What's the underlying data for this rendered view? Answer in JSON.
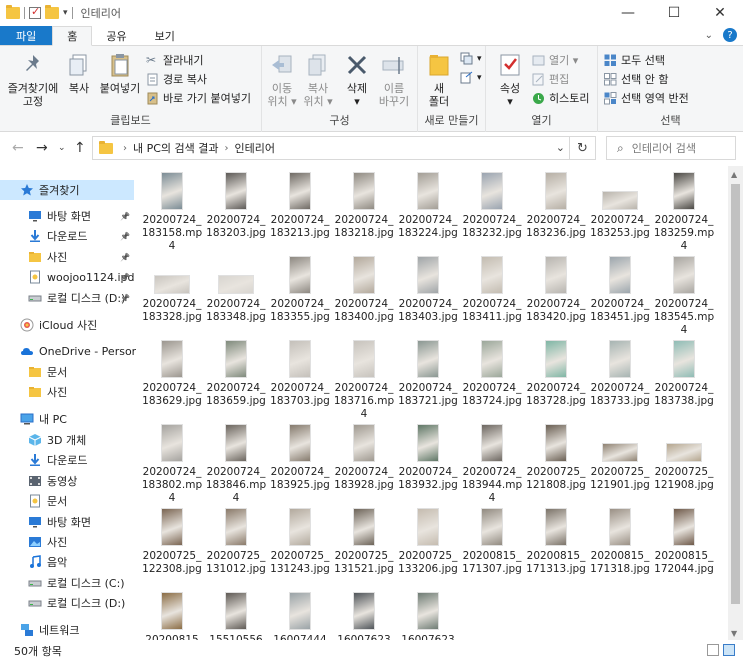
{
  "window": {
    "title": "인테리어",
    "controls": [
      "—",
      "☐",
      "✕"
    ]
  },
  "tabs": [
    {
      "label": "파일"
    },
    {
      "label": "홈"
    },
    {
      "label": "공유"
    },
    {
      "label": "보기"
    }
  ],
  "ribbon": {
    "clipboard": {
      "label": "클립보드",
      "pin": "즐겨찾기에\n고정",
      "copy": "복사",
      "paste": "붙여넣기",
      "cut": "잘라내기",
      "copy_path": "경로 복사",
      "paste_shortcut": "바로 가기 붙여넣기"
    },
    "organize": {
      "label": "구성",
      "move_to": "이동\n위치 ▾",
      "copy_to": "복사\n위치 ▾",
      "delete": "삭제\n▾",
      "rename": "이름\n바꾸기"
    },
    "new": {
      "label": "새로 만들기",
      "new_folder": "새\n폴더"
    },
    "open": {
      "label": "열기",
      "properties": "속성\n▾",
      "open": "열기 ▾",
      "edit": "편집",
      "history": "히스토리"
    },
    "select": {
      "label": "선택",
      "select_all": "모두 선택",
      "select_none": "선택 안 함",
      "invert": "선택 영역 반전"
    }
  },
  "address": {
    "crumbs": [
      "내 PC의 검색 결과",
      "인테리어"
    ],
    "search_placeholder": "인테리어 검색"
  },
  "nav": [
    {
      "label": "즐겨찾기",
      "icon": "star-icon",
      "pin": false,
      "selected": true
    },
    {
      "label": "바탕 화면",
      "icon": "desktop-icon",
      "pin": true
    },
    {
      "label": "다운로드",
      "icon": "download-icon",
      "pin": true
    },
    {
      "label": "사진",
      "icon": "folder-icon",
      "pin": true
    },
    {
      "label": "woojoo1124.ipd",
      "icon": "document-icon",
      "pin": true
    },
    {
      "label": "로컬 디스크 (D:)",
      "icon": "disk-icon",
      "pin": true
    },
    {
      "label": "iCloud 사진",
      "icon": "icloud-icon"
    },
    {
      "label": "OneDrive - Personal",
      "icon": "cloud-icon"
    },
    {
      "label": "문서",
      "icon": "folder-icon"
    },
    {
      "label": "사진",
      "icon": "folder-icon"
    },
    {
      "label": "내 PC",
      "icon": "pc-icon"
    },
    {
      "label": "3D 개체",
      "icon": "3d-icon"
    },
    {
      "label": "다운로드",
      "icon": "download-icon"
    },
    {
      "label": "동영상",
      "icon": "video-icon"
    },
    {
      "label": "문서",
      "icon": "document-icon"
    },
    {
      "label": "바탕 화면",
      "icon": "desktop-icon"
    },
    {
      "label": "사진",
      "icon": "picture-icon"
    },
    {
      "label": "음악",
      "icon": "music-icon"
    },
    {
      "label": "로컬 디스크 (C:)",
      "icon": "disk-icon"
    },
    {
      "label": "로컬 디스크 (D:)",
      "icon": "disk-icon"
    },
    {
      "label": "네트워크",
      "icon": "network-icon"
    }
  ],
  "files": [
    {
      "name": "20200724_183158.mp4",
      "shape": "p",
      "tone": "#7b8c95"
    },
    {
      "name": "20200724_183203.jpg",
      "shape": "p",
      "tone": "#5d5a57"
    },
    {
      "name": "20200724_183213.jpg",
      "shape": "p",
      "tone": "#6f6a64"
    },
    {
      "name": "20200724_183218.jpg",
      "shape": "p",
      "tone": "#8f8a82"
    },
    {
      "name": "20200724_183224.jpg",
      "shape": "p",
      "tone": "#a39e96"
    },
    {
      "name": "20200724_183232.jpg",
      "shape": "p",
      "tone": "#9aa4b0"
    },
    {
      "name": "20200724_183236.jpg",
      "shape": "p",
      "tone": "#b6afa5"
    },
    {
      "name": "20200724_183253.jpg",
      "shape": "l",
      "tone": "#b9b4ac"
    },
    {
      "name": "20200724_183259.mp4",
      "shape": "p",
      "tone": "#4a4844"
    },
    {
      "name": "20200724_183328.jpg",
      "shape": "l",
      "tone": "#c9c5bf"
    },
    {
      "name": "20200724_183348.jpg",
      "shape": "l",
      "tone": "#d8d5d0"
    },
    {
      "name": "20200724_183355.jpg",
      "shape": "p",
      "tone": "#8d8881"
    },
    {
      "name": "20200724_183400.jpg",
      "shape": "p",
      "tone": "#b3a99c"
    },
    {
      "name": "20200724_183403.jpg",
      "shape": "p",
      "tone": "#a0a5a8"
    },
    {
      "name": "20200724_183411.jpg",
      "shape": "p",
      "tone": "#c3bcb1"
    },
    {
      "name": "20200724_183420.jpg",
      "shape": "p",
      "tone": "#b8b5b0"
    },
    {
      "name": "20200724_183451.jpg",
      "shape": "p",
      "tone": "#9ca6ad"
    },
    {
      "name": "20200724_183545.mp4",
      "shape": "p",
      "tone": "#a9a6a1"
    },
    {
      "name": "20200724_183629.jpg",
      "shape": "p",
      "tone": "#9b968f"
    },
    {
      "name": "20200724_183659.jpg",
      "shape": "p",
      "tone": "#7f8a7c"
    },
    {
      "name": "20200724_183703.jpg",
      "shape": "p",
      "tone": "#c4c0ba"
    },
    {
      "name": "20200724_183716.mp4",
      "shape": "p",
      "tone": "#c7c3bd"
    },
    {
      "name": "20200724_183721.jpg",
      "shape": "p",
      "tone": "#8a9792"
    },
    {
      "name": "20200724_183724.jpg",
      "shape": "p",
      "tone": "#9ba79a"
    },
    {
      "name": "20200724_183728.jpg",
      "shape": "p",
      "tone": "#7fb6a5"
    },
    {
      "name": "20200724_183733.jpg",
      "shape": "p",
      "tone": "#a7b4b2"
    },
    {
      "name": "20200724_183738.jpg",
      "shape": "p",
      "tone": "#8fbcb5"
    },
    {
      "name": "20200724_183802.mp4",
      "shape": "p",
      "tone": "#a5a39f"
    },
    {
      "name": "20200724_183846.mp4",
      "shape": "p",
      "tone": "#6b655e"
    },
    {
      "name": "20200724_183925.jpg",
      "shape": "p",
      "tone": "#857a6d"
    },
    {
      "name": "20200724_183928.jpg",
      "shape": "p",
      "tone": "#9f9990"
    },
    {
      "name": "20200724_183932.jpg",
      "shape": "p",
      "tone": "#5f7766"
    },
    {
      "name": "20200724_183944.mp4",
      "shape": "p",
      "tone": "#6c6660"
    },
    {
      "name": "20200725_121808.jpg",
      "shape": "p",
      "tone": "#6a5f53"
    },
    {
      "name": "20200725_121901.jpg",
      "shape": "l",
      "tone": "#8f8272"
    },
    {
      "name": "20200725_121908.jpg",
      "shape": "l",
      "tone": "#b4a58e"
    },
    {
      "name": "20200725_122308.jpg",
      "shape": "p",
      "tone": "#7a6552"
    },
    {
      "name": "20200725_131012.jpg",
      "shape": "p",
      "tone": "#8a7a6a"
    },
    {
      "name": "20200725_131243.jpg",
      "shape": "p",
      "tone": "#b3aa9e"
    },
    {
      "name": "20200725_131521.jpg",
      "shape": "p",
      "tone": "#6d6459"
    },
    {
      "name": "20200725_133206.jpg",
      "shape": "p",
      "tone": "#c5bcb0"
    },
    {
      "name": "20200815_171307.jpg",
      "shape": "p",
      "tone": "#918a80"
    },
    {
      "name": "20200815_171313.jpg",
      "shape": "p",
      "tone": "#7b7369"
    },
    {
      "name": "20200815_171318.jpg",
      "shape": "p",
      "tone": "#9a9085"
    },
    {
      "name": "20200815_172044.jpg",
      "shape": "p",
      "tone": "#6f5a4a"
    },
    {
      "name": "20200815",
      "shape": "p",
      "tone": "#8b6d45"
    },
    {
      "name": "15510556",
      "shape": "p",
      "tone": "#5f5a55"
    },
    {
      "name": "16007444",
      "shape": "p",
      "tone": "#9aa3a7"
    },
    {
      "name": "16007623",
      "shape": "p",
      "tone": "#50555a"
    },
    {
      "name": "16007623",
      "shape": "p",
      "tone": "#6f7c74"
    }
  ],
  "status": {
    "count": "50개 항목"
  }
}
